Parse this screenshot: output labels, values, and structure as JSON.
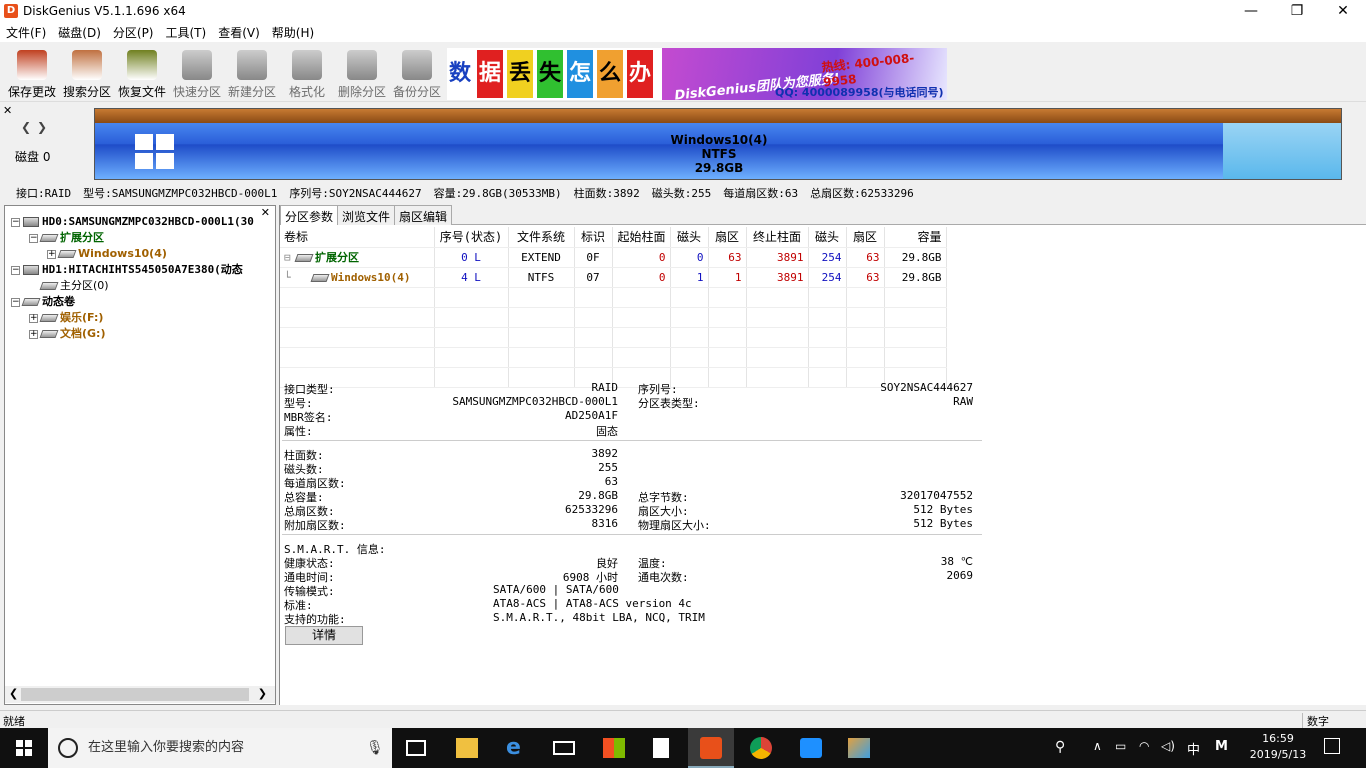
{
  "window": {
    "title": "DiskGenius V5.1.1.696 x64",
    "app_icon": "D",
    "min": "—",
    "max": "❐",
    "close": "✕"
  },
  "menu": [
    "文件(F)",
    "磁盘(D)",
    "分区(P)",
    "工具(T)",
    "查看(V)",
    "帮助(H)"
  ],
  "toolbar": [
    {
      "label": "保存更改",
      "icon": "save-icon",
      "color": "#c04020",
      "enabled": true
    },
    {
      "label": "搜索分区",
      "icon": "magnifier-icon",
      "color": "#c07040",
      "enabled": true
    },
    {
      "label": "恢复文件",
      "icon": "box-recover-icon",
      "color": "#708020",
      "enabled": true
    },
    {
      "label": "快速分区",
      "icon": "quick-partition-icon",
      "color": "#a0a0a0",
      "enabled": false
    },
    {
      "label": "新建分区",
      "icon": "new-partition-icon",
      "color": "#a0a0a0",
      "enabled": false
    },
    {
      "label": "格式化",
      "icon": "format-icon",
      "color": "#a0a0a0",
      "enabled": false
    },
    {
      "label": "删除分区",
      "icon": "trash-icon",
      "color": "#a0a0a0",
      "enabled": false
    },
    {
      "label": "备份分区",
      "icon": "backup-icon",
      "color": "#a0a0a0",
      "enabled": false
    }
  ],
  "banner": {
    "tiles": [
      "数",
      "据",
      "丢",
      "失",
      "怎",
      "么",
      "办"
    ],
    "promo": "DiskGenius团队为您服务!",
    "phone": "热线: 400-008-9958",
    "qq": "QQ: 4000089958(与电话同号)"
  },
  "disk_nav": {
    "label": "磁盘 0",
    "left_arrow": "❮",
    "right_arrow": "❯",
    "close": "✕"
  },
  "diskbar": {
    "name": "Windows10(4)",
    "fs": "NTFS",
    "size": "29.8GB",
    "free_fraction": 0.095
  },
  "infoline": [
    "接口:RAID",
    "型号:SAMSUNGMZMPC032HBCD-000L1",
    "序列号:SOY2NSAC444627",
    "容量:29.8GB(30533MB)",
    "柱面数:3892",
    "磁头数:255",
    "每道扇区数:63",
    "总扇区数:62533296"
  ],
  "tree": {
    "close": "✕",
    "items": [
      {
        "text": "HD0:SAMSUNGMZMPC032HBCD-000L1(30",
        "type": "disk",
        "pm": "−",
        "indent": 0
      },
      {
        "text": "扩展分区",
        "type": "ext",
        "pm": "−",
        "indent": 1
      },
      {
        "text": "Windows10(4)",
        "type": "part",
        "pm": "+",
        "indent": 2
      },
      {
        "text": "HD1:HITACHIHTS545050A7E380(动态",
        "type": "disk",
        "pm": "−",
        "indent": 0
      },
      {
        "text": "主分区(0)",
        "type": "plain",
        "pm": "",
        "indent": 1
      },
      {
        "text": "动态卷",
        "type": "dyn",
        "pm": "−",
        "indent": 0
      },
      {
        "text": "娱乐(F:)",
        "type": "vol",
        "pm": "+",
        "indent": 1
      },
      {
        "text": "文档(G:)",
        "type": "vol",
        "pm": "+",
        "indent": 1
      }
    ]
  },
  "tabs": [
    "分区参数",
    "浏览文件",
    "扇区编辑"
  ],
  "table": {
    "headers": [
      "卷标",
      "序号(状态)",
      "文件系统",
      "标识",
      "起始柱面",
      "磁头",
      "扇区",
      "终止柱面",
      "磁头",
      "扇区",
      "容量"
    ],
    "rows": [
      [
        "扩展分区",
        "0 L",
        "EXTEND",
        "0F",
        "0",
        "0",
        "63",
        "3891",
        "254",
        "63",
        "29.8GB"
      ],
      [
        "Windows10(4)",
        "4 L",
        "NTFS",
        "07",
        "0",
        "1",
        "1",
        "3891",
        "254",
        "63",
        "29.8GB"
      ]
    ]
  },
  "details": {
    "left": [
      [
        "接口类型:",
        "RAID"
      ],
      [
        "型号:",
        "SAMSUNGMZMPC032HBCD-000L1"
      ],
      [
        "MBR签名:",
        "AD250A1F"
      ],
      [
        "属性:",
        "固态"
      ]
    ],
    "right": [
      [
        "序列号:",
        "SOY2NSAC444627"
      ],
      [
        "分区表类型:",
        "RAW"
      ]
    ],
    "geo_left": [
      [
        "柱面数:",
        "3892"
      ],
      [
        "磁头数:",
        "255"
      ],
      [
        "每道扇区数:",
        "63"
      ],
      [
        "总容量:",
        "29.8GB"
      ],
      [
        "总扇区数:",
        "62533296"
      ],
      [
        "附加扇区数:",
        "8316"
      ]
    ],
    "geo_right": [
      [
        "总字节数:",
        "32017047552"
      ],
      [
        "扇区大小:",
        "512 Bytes"
      ],
      [
        "物理扇区大小:",
        "512 Bytes"
      ]
    ],
    "smart_title": "S.M.A.R.T. 信息:",
    "smart_left": [
      [
        "健康状态:",
        "良好"
      ],
      [
        "通电时间:",
        "6908 小时"
      ]
    ],
    "smart_right": [
      [
        "温度:",
        "38 ℃"
      ],
      [
        "通电次数:",
        "2069"
      ]
    ],
    "smart_full": [
      [
        "传输模式:",
        "SATA/600 | SATA/600"
      ],
      [
        "标准:",
        "ATA8-ACS | ATA8-ACS version 4c"
      ],
      [
        "支持的功能:",
        "S.M.A.R.T., 48bit LBA, NCQ, TRIM"
      ]
    ],
    "button": "详情"
  },
  "status": {
    "left": "就绪",
    "right": "数字"
  },
  "taskbar": {
    "search": "在这里输入你要搜索的内容",
    "time": "16:59",
    "date": "2019/5/13",
    "ime": "中",
    "ime2": "M"
  }
}
